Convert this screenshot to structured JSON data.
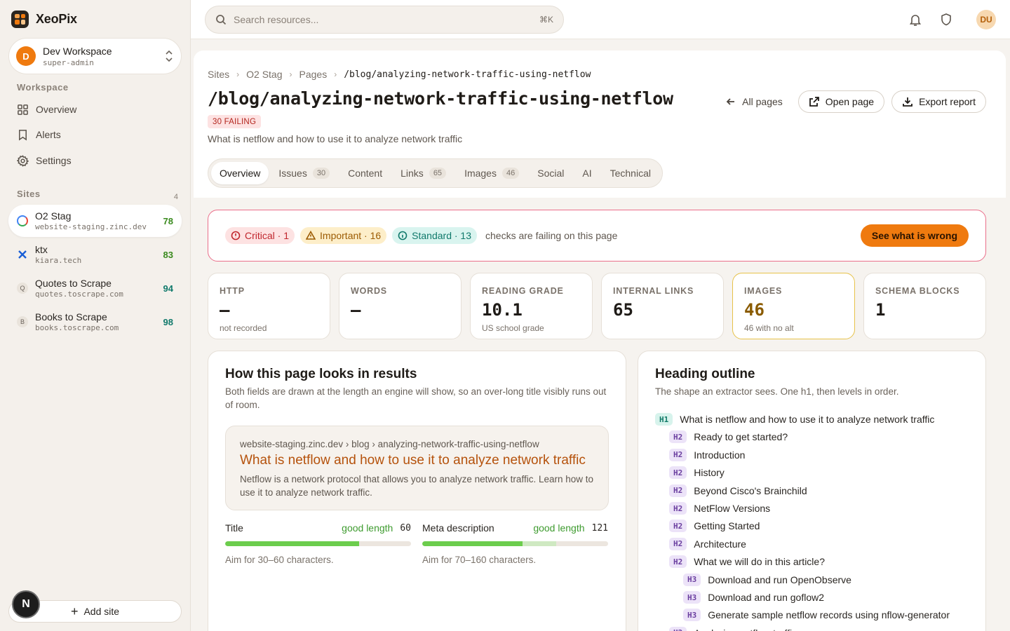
{
  "app": {
    "brand": "XeoPix"
  },
  "workspace": {
    "name": "Dev Workspace",
    "role": "super-admin",
    "initial": "D"
  },
  "sidebar": {
    "workspace_heading": "Workspace",
    "nav": [
      {
        "label": "Overview",
        "icon": "grid-icon"
      },
      {
        "label": "Alerts",
        "icon": "bookmark-icon"
      },
      {
        "label": "Settings",
        "icon": "gear-icon"
      }
    ],
    "sites_heading": "Sites",
    "sites_count": "4",
    "sites": [
      {
        "name": "O2 Stag",
        "host": "website-staging.zinc.dev",
        "score": "78",
        "fav": ""
      },
      {
        "name": "ktx",
        "host": "kiara.tech",
        "score": "83",
        "fav": ""
      },
      {
        "name": "Quotes to Scrape",
        "host": "quotes.toscrape.com",
        "score": "94",
        "fav": "Q"
      },
      {
        "name": "Books to Scrape",
        "host": "books.toscrape.com",
        "score": "98",
        "fav": "B"
      }
    ],
    "add_site": "Add site",
    "n_badge": "N"
  },
  "topbar": {
    "search_placeholder": "Search resources...",
    "shortcut": "⌘K",
    "user_initials": "DU"
  },
  "breadcrumb": [
    "Sites",
    "O2 Stag",
    "Pages",
    "/blog/analyzing-network-traffic-using-netflow"
  ],
  "page": {
    "title": "/blog/analyzing-network-traffic-using-netflow",
    "failing_badge": "30 FAILING",
    "subtitle": "What is netflow and how to use it to analyze network traffic",
    "all_pages": "All pages",
    "open_page": "Open page",
    "export_report": "Export report"
  },
  "tabs": [
    {
      "label": "Overview",
      "count": ""
    },
    {
      "label": "Issues",
      "count": "30"
    },
    {
      "label": "Content",
      "count": ""
    },
    {
      "label": "Links",
      "count": "65"
    },
    {
      "label": "Images",
      "count": "46"
    },
    {
      "label": "Social",
      "count": ""
    },
    {
      "label": "AI",
      "count": ""
    },
    {
      "label": "Technical",
      "count": ""
    }
  ],
  "alert": {
    "critical": "Critical · 1",
    "important": "Important · 16",
    "standard": "Standard · 13",
    "text": "checks are failing on this page",
    "button": "See what is wrong",
    "colors": {
      "critical": "#c0262d",
      "important": "#9c5b03",
      "standard": "#10796b",
      "accent": "#ef7a0f"
    }
  },
  "stats": [
    {
      "label": "HTTP",
      "value": "—",
      "note": "not recorded"
    },
    {
      "label": "WORDS",
      "value": "—",
      "note": ""
    },
    {
      "label": "READING GRADE",
      "value": "10.1",
      "note": "US school grade"
    },
    {
      "label": "INTERNAL LINKS",
      "value": "65",
      "note": ""
    },
    {
      "label": "IMAGES",
      "value": "46",
      "note": "46 with no alt"
    },
    {
      "label": "SCHEMA BLOCKS",
      "value": "1",
      "note": ""
    }
  ],
  "serp_card": {
    "title": "How this page looks in results",
    "subtitle": "Both fields are drawn at the length an engine will show, so an over-long title visibly runs out of room.",
    "url": "website-staging.zinc.dev › blog › analyzing-network-traffic-using-netflow",
    "result_title": "What is netflow and how to use it to analyze network traffic",
    "result_desc": "Netflow is a network protocol that allows you to analyze network traffic. Learn how to use it to analyze network traffic.",
    "meters": [
      {
        "label": "Title",
        "status": "good length",
        "count": "60",
        "hint": "Aim for 30–60 characters.",
        "fill": 0.72,
        "zone": 0
      },
      {
        "label": "Meta description",
        "status": "good length",
        "count": "121",
        "hint": "Aim for 70–160 characters.",
        "fill": 0.54,
        "zone": 0.18
      }
    ]
  },
  "outline_card": {
    "title": "Heading outline",
    "subtitle": "The shape an extractor sees. One h1, then levels in order.",
    "headings": [
      {
        "level": "H1",
        "text": "What is netflow and how to use it to analyze network traffic"
      },
      {
        "level": "H2",
        "text": "Ready to get started?"
      },
      {
        "level": "H2",
        "text": "Introduction"
      },
      {
        "level": "H2",
        "text": "History"
      },
      {
        "level": "H2",
        "text": "Beyond Cisco's Brainchild"
      },
      {
        "level": "H2",
        "text": "NetFlow Versions"
      },
      {
        "level": "H2",
        "text": "Getting Started"
      },
      {
        "level": "H2",
        "text": "Architecture"
      },
      {
        "level": "H2",
        "text": "What we will do in this article?"
      },
      {
        "level": "H3",
        "text": "Download and run OpenObserve"
      },
      {
        "level": "H3",
        "text": "Download and run goflow2"
      },
      {
        "level": "H3",
        "text": "Generate sample netflow records using nflow-generator"
      },
      {
        "level": "H2",
        "text": "Analyzing netflow traffic"
      }
    ]
  }
}
